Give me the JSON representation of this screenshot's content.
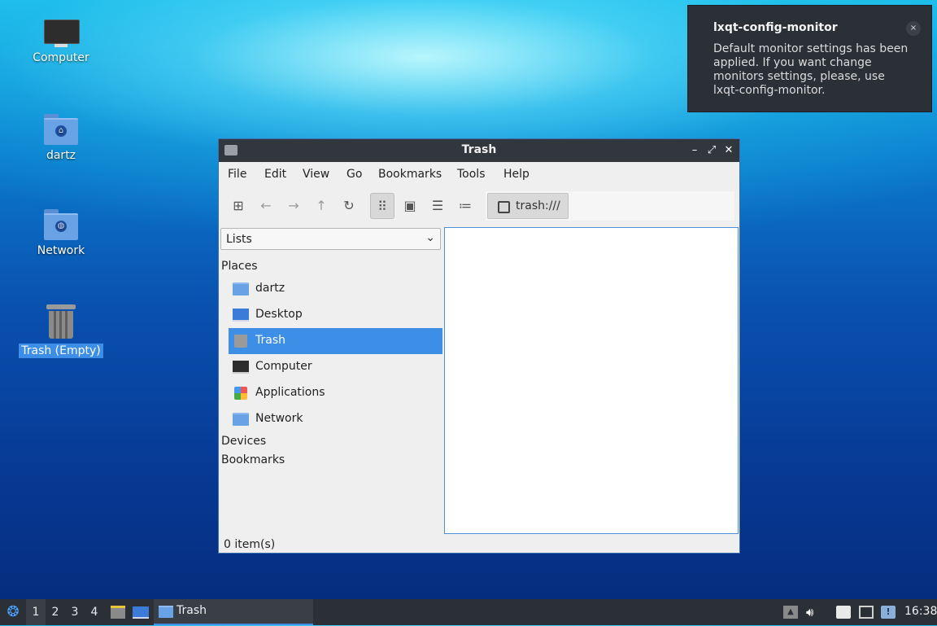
{
  "desktop": {
    "icons": [
      {
        "label": "Computer",
        "icon": "computer-icon"
      },
      {
        "label": "dartz",
        "icon": "home-folder-icon"
      },
      {
        "label": "Network",
        "icon": "network-folder-icon"
      },
      {
        "label": "Trash (Empty)",
        "icon": "trash-icon"
      }
    ]
  },
  "notification": {
    "title": "lxqt-config-monitor",
    "body": "Default monitor settings has been applied. If you want change monitors settings, please, use lxqt-config-monitor.",
    "close": "×"
  },
  "window": {
    "title": "Trash",
    "controls": {
      "minimize": "–",
      "maximize": "⤢",
      "close": "✕"
    },
    "menu": [
      "File",
      "Edit",
      "View",
      "Go",
      "Bookmarks",
      "Tools",
      "Help"
    ],
    "path": "trash:///",
    "sidebar": {
      "mode": "Lists",
      "places_label": "Places",
      "places": [
        {
          "label": "dartz",
          "icon": "home-folder-icon"
        },
        {
          "label": "Desktop",
          "icon": "desktop-icon"
        },
        {
          "label": "Trash",
          "icon": "trash-icon",
          "selected": true
        },
        {
          "label": "Computer",
          "icon": "computer-icon"
        },
        {
          "label": "Applications",
          "icon": "applications-icon"
        },
        {
          "label": "Network",
          "icon": "network-folder-icon"
        }
      ],
      "devices_label": "Devices",
      "bookmarks_label": "Bookmarks"
    },
    "status": "0 item(s)"
  },
  "taskbar": {
    "workspaces": [
      "1",
      "2",
      "3",
      "4"
    ],
    "active_workspace": "1",
    "task_label": "Trash",
    "clock": "16:38"
  },
  "colors": {
    "accent": "#3d8ee6",
    "panel": "#2b2f36",
    "titlebar": "#32363d"
  }
}
